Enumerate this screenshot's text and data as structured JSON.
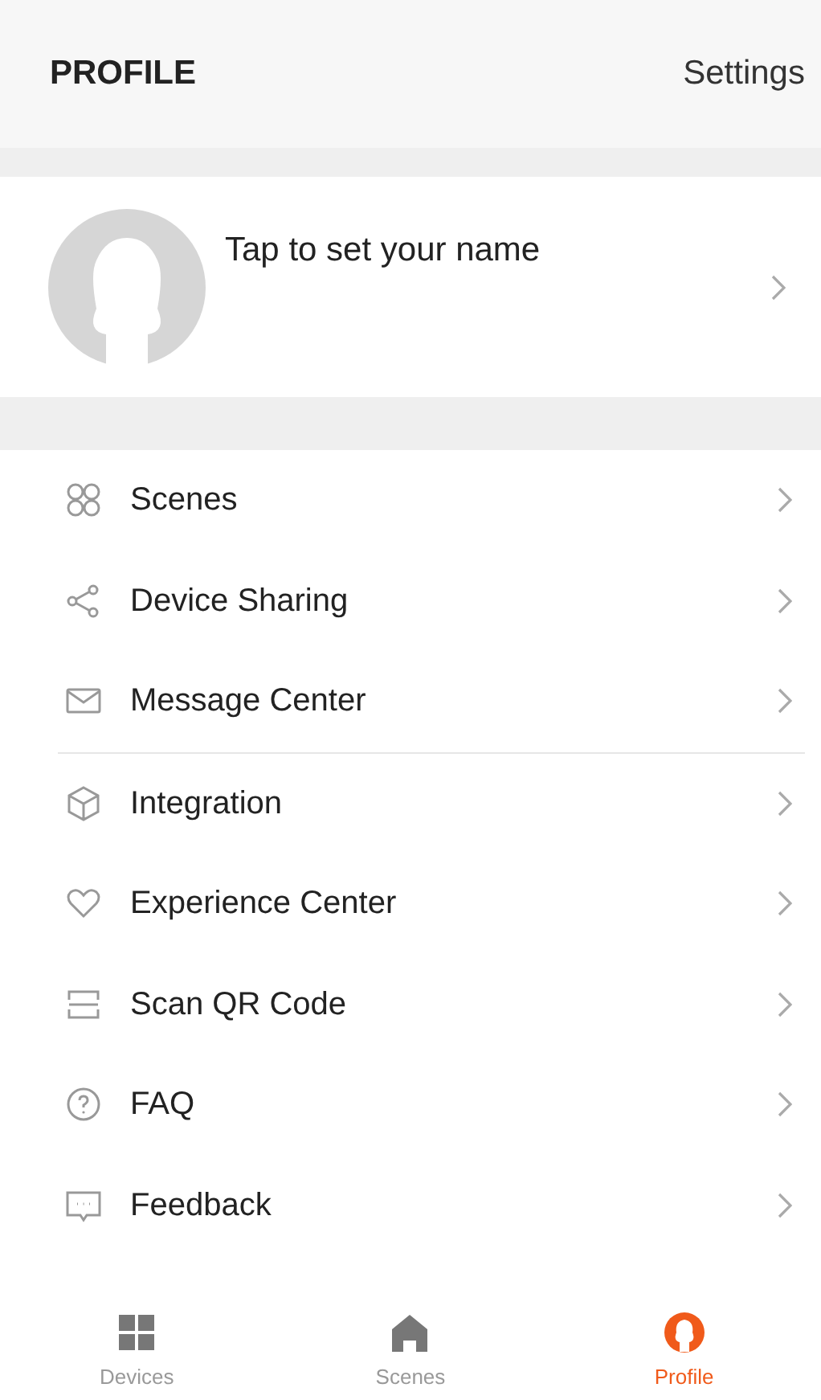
{
  "header": {
    "title": "PROFILE",
    "action": "Settings"
  },
  "profile": {
    "name_prompt": "Tap to set your name"
  },
  "menu_groups": [
    [
      {
        "label": "Scenes"
      },
      {
        "label": "Device Sharing"
      },
      {
        "label": "Message Center"
      }
    ],
    [
      {
        "label": "Integration"
      },
      {
        "label": "Experience Center"
      },
      {
        "label": "Scan QR Code"
      },
      {
        "label": "FAQ"
      },
      {
        "label": "Feedback"
      }
    ]
  ],
  "tabs": [
    {
      "label": "Devices",
      "selected": false
    },
    {
      "label": "Scenes",
      "selected": false
    },
    {
      "label": "Profile",
      "selected": true
    }
  ]
}
